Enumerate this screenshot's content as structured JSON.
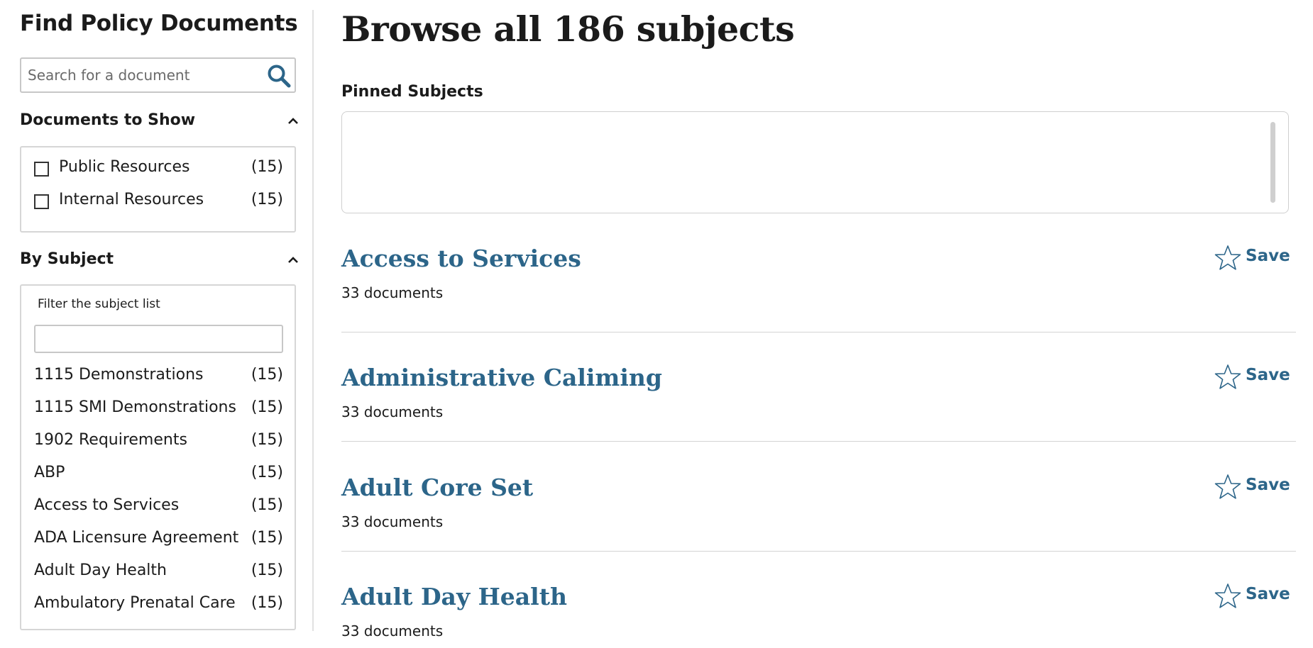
{
  "sidebar": {
    "title": "Find Policy Documents",
    "search": {
      "placeholder": "Search for a document",
      "value": ""
    },
    "documents_to_show": {
      "heading": "Documents to Show",
      "options": [
        {
          "label": "Public Resources",
          "count": "(15)",
          "checked": false
        },
        {
          "label": "Internal Resources",
          "count": "(15)",
          "checked": false
        }
      ]
    },
    "by_subject": {
      "heading": "By Subject",
      "filter_label": "Filter the subject list",
      "filter_value": "",
      "items": [
        {
          "name": "1115 Demonstrations",
          "count": "(15)"
        },
        {
          "name": "1115 SMI Demonstrations",
          "count": "(15)"
        },
        {
          "name": "1902 Requirements",
          "count": "(15)"
        },
        {
          "name": "ABP",
          "count": "(15)"
        },
        {
          "name": "Access to Services",
          "count": "(15)"
        },
        {
          "name": "ADA Licensure Agreement",
          "count": "(15)"
        },
        {
          "name": "Adult Day Health",
          "count": "(15)"
        },
        {
          "name": "Ambulatory Prenatal Care",
          "count": "(15)"
        }
      ]
    }
  },
  "main": {
    "title": "Browse all 186 subjects",
    "pinned_label": "Pinned Subjects",
    "subjects": [
      {
        "title": "Access to Services",
        "docs": "33 documents",
        "save_label": "Save"
      },
      {
        "title": "Administrative Caliming",
        "docs": "33 documents",
        "save_label": "Save"
      },
      {
        "title": "Adult Core Set",
        "docs": "33 documents",
        "save_label": "Save"
      },
      {
        "title": "Adult Day Health",
        "docs": "33 documents",
        "save_label": "Save"
      }
    ]
  },
  "colors": {
    "link": "#2c6589",
    "text": "#1b1b1b",
    "border": "#d6d6d6"
  }
}
